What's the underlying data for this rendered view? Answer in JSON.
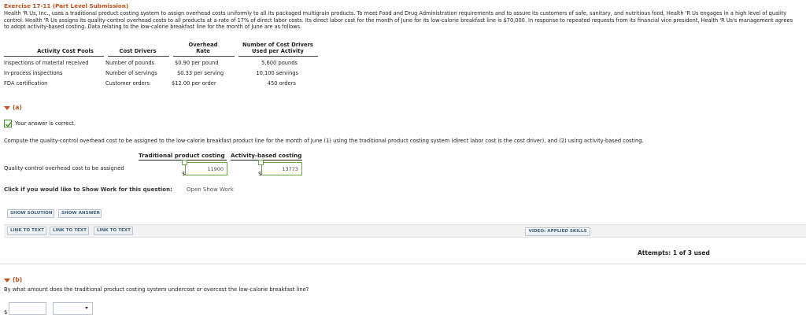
{
  "exercise": {
    "title": "Exercise 17-11 (Part Level Submission)",
    "intro": "Health 'R Us, Inc., uses a traditional product costing system to assign overhead costs uniformly to all its packaged multigrain products. To meet Food and Drug Administration requirements and to assure its customers of safe, sanitary, and nutritious food, Health 'R Us engages in a high level of quality control. Health 'R Us assigns its quality-control overhead costs to all products at a rate of 17% of direct labor costs. Its direct labor cost for the month of June for its low-calorie breakfast line is $70,000. In response to repeated requests from its financial vice president, Health 'R Us's management agrees to adopt activity-based costing. Data relating to the low-calorie breakfast line for the month of June are as follows."
  },
  "cost_table": {
    "headers": {
      "pools": "Activity Cost Pools",
      "drivers": "Cost Drivers",
      "rate_line1": "Overhead",
      "rate_line2": "Rate",
      "used_line1": "Number of Cost Drivers",
      "used_line2": "Used per Activity"
    },
    "rows": [
      {
        "pool": "Inspections of material received",
        "driver": "Number of pounds",
        "rate": "$0.90  per pound",
        "used": "5,600  pounds"
      },
      {
        "pool": "In-process inspections",
        "driver": "Number of servings",
        "rate": "$0.33  per serving",
        "used": "10,100  servings"
      },
      {
        "pool": "FDA certification",
        "driver": "Customer orders",
        "rate": "$12.00  per order",
        "used": "450  orders"
      }
    ]
  },
  "part_a": {
    "label": "(a)",
    "status": "Your answer is correct.",
    "question": "Compute the quality-control overhead cost to be assigned to the low-calorie breakfast product line for the month of June (1) using the traditional product costing system (direct labor cost is the cost driver), and (2) using activity-based costing.",
    "col_traditional": "Traditional product costing",
    "col_abc": "Activity-based costing",
    "row_label": "Quality-control overhead cost to be assigned",
    "currency": "$",
    "traditional_value": "11900",
    "abc_value": "13773",
    "show_work_prompt": "Click if you would like to Show Work for this question:",
    "open_show_work": "Open Show Work",
    "buttons": {
      "show_solution": "SHOW SOLUTION",
      "show_answer": "SHOW ANSWER"
    },
    "links": [
      "LINK TO TEXT",
      "LINK TO TEXT",
      "LINK TO TEXT"
    ],
    "video": "VIDEO: APPLIED SKILLS",
    "attempts": "Attempts: 1 of 3 used"
  },
  "part_b": {
    "label": "(b)",
    "question": "By what amount does the traditional product costing system undercost or overcost the low-calorie breakfast line?",
    "currency": "$",
    "amount_value": "",
    "select_value": ""
  },
  "colors": {
    "accent": "#c8501c",
    "correct": "#4a8f2a",
    "button_text": "#3c5a7a"
  }
}
